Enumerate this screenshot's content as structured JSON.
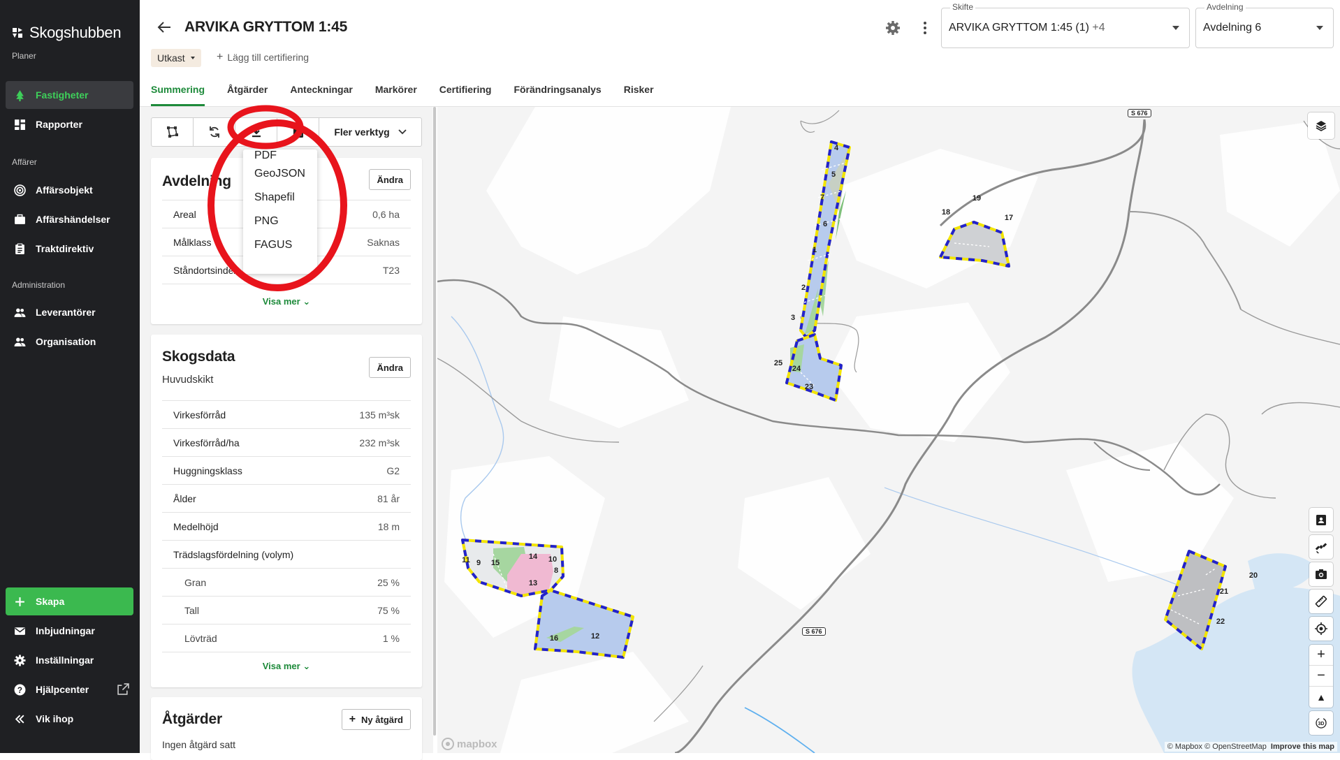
{
  "app": {
    "name": "Skogshubben"
  },
  "sidebar": {
    "sections": [
      {
        "label": "Planer"
      },
      {
        "label": "Affärer"
      },
      {
        "label": "Administration"
      }
    ],
    "items": [
      {
        "label": "Fastigheter",
        "icon": "tree-icon"
      },
      {
        "label": "Rapporter",
        "icon": "dashboard-icon"
      },
      {
        "label": "Affärsobjekt",
        "icon": "target-icon"
      },
      {
        "label": "Affärshändelser",
        "icon": "briefcase-icon"
      },
      {
        "label": "Traktdirektiv",
        "icon": "clipboard-icon"
      },
      {
        "label": "Leverantörer",
        "icon": "people-icon"
      },
      {
        "label": "Organisation",
        "icon": "people-icon"
      }
    ],
    "bottom": [
      {
        "label": "Skapa",
        "icon": "plus-icon"
      },
      {
        "label": "Inbjudningar",
        "icon": "mail-icon"
      },
      {
        "label": "Inställningar",
        "icon": "gear-icon"
      },
      {
        "label": "Hjälpcenter",
        "icon": "help-icon"
      },
      {
        "label": "Vik ihop",
        "icon": "collapse-icon"
      }
    ]
  },
  "header": {
    "title": "ARVIKA GRYTTOM 1:45",
    "status": "Utkast",
    "add_cert": "Lägg till certifiering",
    "skifte": {
      "label": "Skifte",
      "value": "ARVIKA GRYTTOM 1:45 (1)",
      "extra": "+4"
    },
    "avdelning": {
      "label": "Avdelning",
      "value": "Avdelning 6"
    }
  },
  "tabs": [
    "Summering",
    "Åtgärder",
    "Anteckningar",
    "Markörer",
    "Certifiering",
    "Förändringsanalys",
    "Risker"
  ],
  "toolbar": {
    "more": "Fler verktyg"
  },
  "download_menu": [
    "PDF",
    "GeoJSON",
    "Shapefil",
    "PNG",
    "FAGUS"
  ],
  "avdelning_card": {
    "title": "Avdelning",
    "edit": "Ändra",
    "rows": [
      {
        "k": "Areal",
        "v": "0,6 ha"
      },
      {
        "k": "Målklass",
        "v": "Saknas"
      },
      {
        "k": "Ståndortsindex",
        "v": "T23"
      }
    ],
    "more": "Visa mer"
  },
  "skogsdata_card": {
    "title": "Skogsdata",
    "subtitle": "Huvudskikt",
    "edit": "Ändra",
    "rows": [
      {
        "k": "Virkesförråd",
        "v": "135 m³sk"
      },
      {
        "k": "Virkesförråd/ha",
        "v": "232 m³sk"
      },
      {
        "k": "Huggningsklass",
        "v": "G2"
      },
      {
        "k": "Ålder",
        "v": "81 år"
      },
      {
        "k": "Medelhöjd",
        "v": "18 m"
      },
      {
        "k": "Trädslagsfördelning (volym)",
        "v": ""
      }
    ],
    "species": [
      {
        "k": "Gran",
        "v": "25 %"
      },
      {
        "k": "Tall",
        "v": "75 %"
      },
      {
        "k": "Lövträd",
        "v": "1 %"
      }
    ],
    "more": "Visa mer"
  },
  "atgarder_card": {
    "title": "Åtgärder",
    "new": "Ny åtgärd",
    "empty": "Ingen åtgärd satt"
  },
  "map": {
    "road_labels": [
      "S 676",
      "S 676"
    ],
    "attribution": "© Mapbox © OpenStreetMap",
    "improve": "Improve this map",
    "logo": "mapbox",
    "stand_numbers": [
      "1",
      "2",
      "3",
      "4",
      "5",
      "6",
      "7",
      "8",
      "9",
      "10",
      "11",
      "12",
      "13",
      "14",
      "15",
      "16",
      "17",
      "18",
      "19",
      "20",
      "21",
      "22",
      "23",
      "24",
      "25"
    ]
  },
  "colors": {
    "accent": "#1d8a3a",
    "sidebar_bg": "#1f2023",
    "create": "#3bb94f",
    "stand_border_blue": "#2222cc",
    "stand_border_yellow": "#f2e400",
    "annotation_red": "#e8141c"
  }
}
